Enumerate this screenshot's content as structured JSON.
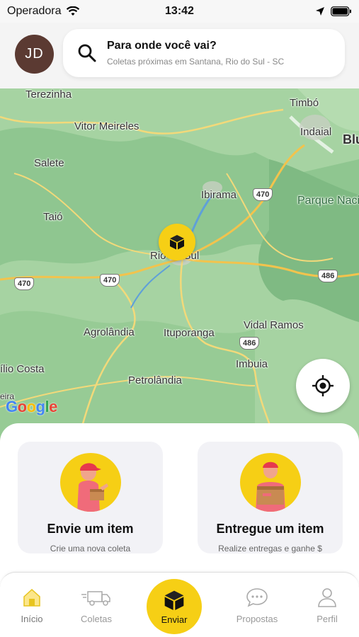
{
  "status_bar": {
    "carrier": "Operadora",
    "time": "13:42"
  },
  "header": {
    "avatar_initials": "JD",
    "search_title": "Para onde você vai?",
    "search_subtitle": "Coletas próximas em Santana, Rio do Sul - SC"
  },
  "map": {
    "labels": {
      "terezinha": "Terezinha",
      "timbo": "Timbó",
      "indaial": "Indaial",
      "blu": "Blu",
      "vitor_meireles": "Vitor Meireles",
      "salete": "Salete",
      "ibirama": "Ibirama",
      "parque": "Parque Nacional d Serra do Ita",
      "taio": "Taió",
      "rio_do_sul": "Rio do Sul",
      "agrolandia": "Agrolândia",
      "ituporanga": "Ituporanga",
      "vidal_ramos": "Vidal Ramos",
      "imbuia": "Imbuia",
      "ilio_costa": "ílio Costa",
      "petrolandia": "Petrolândia",
      "eira": "eira"
    },
    "shields": {
      "s470_top": "470",
      "s470_left": "470",
      "s470_mid": "470",
      "s486_right": "486",
      "s486_mid": "486"
    },
    "google": "Google"
  },
  "cards": {
    "send": {
      "title": "Envie um item",
      "subtitle": "Crie uma nova coleta"
    },
    "deliver": {
      "title": "Entregue um item",
      "subtitle": "Realize entregas e ganhe $"
    }
  },
  "tabs": {
    "home": "Início",
    "coletas": "Coletas",
    "enviar": "Enviar",
    "propostas": "Propostas",
    "perfil": "Perfil"
  },
  "colors": {
    "accent": "#f6cf15",
    "avatar": "#5b3a32",
    "map_green": "#9ccf9b"
  }
}
